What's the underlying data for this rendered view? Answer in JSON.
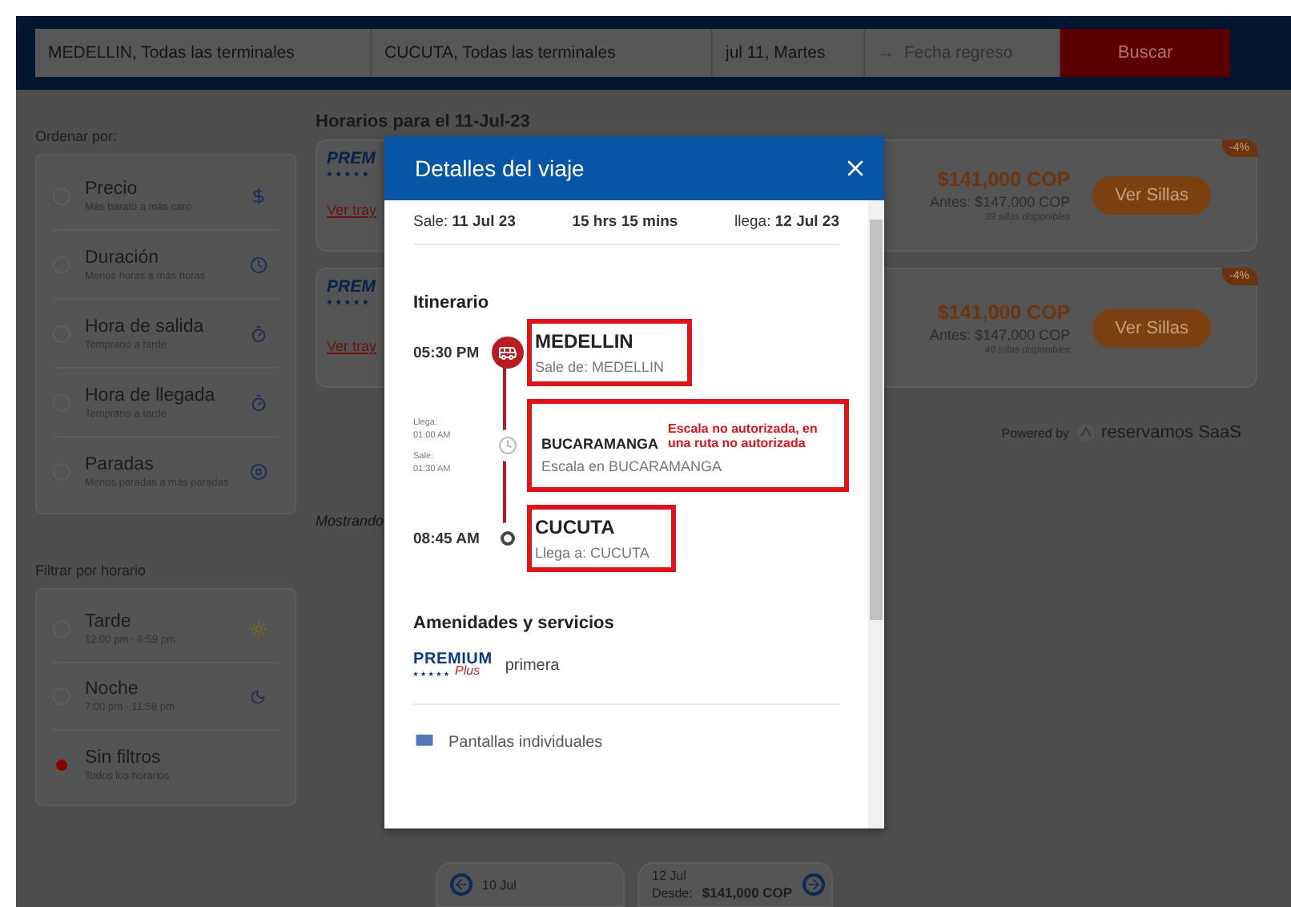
{
  "search": {
    "origin": "MEDELLIN, Todas las terminales",
    "destination": "CUCUTA, Todas las terminales",
    "date": "jul 11, Martes",
    "return_arrow": "→",
    "return_placeholder": "Fecha regreso",
    "button": "Buscar"
  },
  "sort": {
    "title": "Ordenar por:",
    "options": [
      {
        "kind": "price",
        "label": "Precio",
        "hint": "Más barato a más caro",
        "selected": false
      },
      {
        "kind": "duration",
        "label": "Duración",
        "hint": "Menos horas a más horas",
        "selected": false
      },
      {
        "kind": "departure",
        "label": "Hora de salida",
        "hint": "Temprano a tarde",
        "selected": false
      },
      {
        "kind": "arrival",
        "label": "Hora de llegada",
        "hint": "Temprano a tarde",
        "selected": false
      },
      {
        "kind": "stops",
        "label": "Paradas",
        "hint": "Menos paradas a más paradas",
        "selected": false
      }
    ]
  },
  "filter": {
    "title": "Filtrar por horario",
    "options": [
      {
        "kind": "afternoon",
        "label": "Tarde",
        "hint": "12:00 pm - 6:59 pm",
        "selected": false
      },
      {
        "kind": "night",
        "label": "Noche",
        "hint": "7:00 pm - 11:59 pm",
        "selected": false
      },
      {
        "kind": "none",
        "label": "Sin filtros",
        "hint": "Todos los horarios",
        "selected": true
      }
    ]
  },
  "results": {
    "heading": "Horarios para el 11-Jul-23",
    "trips": [
      {
        "logo": "PREM",
        "link": "Ver tray",
        "discount": "-4%",
        "price": "$141,000",
        "currency": "COP",
        "before_label": "Antes:",
        "before_price": "$147,000",
        "before_currency": "COP",
        "seats": "39 sillas disponibles",
        "button": "Ver Sillas"
      },
      {
        "logo": "PREM",
        "link": "Ver tray",
        "discount": "-4%",
        "price": "$141,000",
        "currency": "COP",
        "before_label": "Antes:",
        "before_price": "$147,000",
        "before_currency": "COP",
        "seats": "40 sillas disponibles",
        "button": "Ver Sillas"
      }
    ],
    "powered_by": "Powered by",
    "brand": "reservamos",
    "brand_suffix": "SaaS",
    "showing": "Mostrando"
  },
  "date_nav": {
    "prev": {
      "date": "10 Jul"
    },
    "next": {
      "date": "12 Jul",
      "from_label": "Desde:",
      "price": "$141,000 COP"
    }
  },
  "modal": {
    "title": "Detalles del viaje",
    "summary": {
      "departure": "Sale: **11 Jul 23**",
      "duration": "15 hrs 15 mins",
      "arrival": "llega: **12 Jul 23**"
    },
    "itinerary_title": "Itinerario",
    "stops": [
      {
        "kind": "origin",
        "time": "05:30 PM",
        "city": "MEDELLIN",
        "detail": "Sale de: MEDELLIN",
        "highlighted": true
      },
      {
        "kind": "stopover",
        "arrive_label": "Llega:",
        "arrive_time": "01:00 AM",
        "depart_label": "Sale:",
        "depart_time": "01:30 AM",
        "city": "BUCARAMANGA",
        "note": "Escala no autorizada, en una ruta no autorizada",
        "detail": "Escala en BUCARAMANGA",
        "highlighted": true
      },
      {
        "kind": "destination",
        "time": "08:45 AM",
        "city": "CUCUTA",
        "detail": "Llega a: CUCUTA",
        "highlighted": true
      }
    ],
    "amenities_title": "Amenidades y servicios",
    "service_logo": {
      "text": "PREMIUM",
      "script": "Plus"
    },
    "service_class": "primera",
    "amenities": [
      {
        "label": "Pantallas individuales"
      }
    ]
  }
}
